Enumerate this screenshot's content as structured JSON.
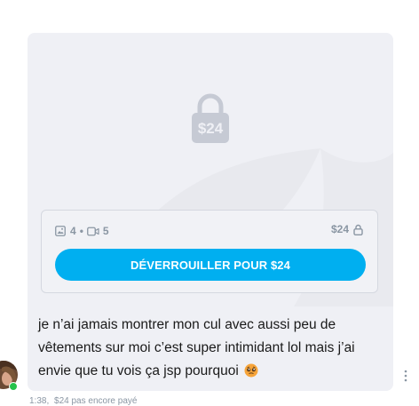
{
  "locked_post": {
    "price_overlay": "$24",
    "stats": {
      "images": "4",
      "separator": "•",
      "videos": "5"
    },
    "price": "$24",
    "unlock_button": "DÉVERROUILLER POUR $24",
    "colors": {
      "accent": "#00aff0",
      "muted": "#8a96a3",
      "card_bg": "#eff0f5"
    }
  },
  "message": {
    "text": "je n’ai jamais montrer mon cul avec aussi peu de vêtements sur moi c’est super intimidant lol mais j’ai envie que tu vois ça jsp pourquoi",
    "emoji": "pleading-face-icon"
  },
  "footer": {
    "time": "1:38,",
    "price": "$24",
    "status": "pas encore payé"
  }
}
